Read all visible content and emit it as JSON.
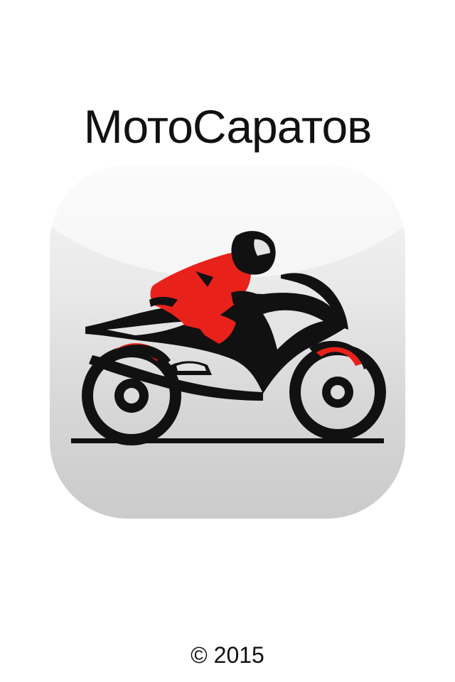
{
  "app": {
    "title": "МотоСаратов",
    "copyright": "© 2015"
  },
  "logo": {
    "icon_name": "motorcycle-rider-icon",
    "colors": {
      "accent": "#e8211b",
      "ink": "#111111",
      "tile_top": "#f6f6f6",
      "tile_bottom": "#cbcbcb"
    }
  }
}
